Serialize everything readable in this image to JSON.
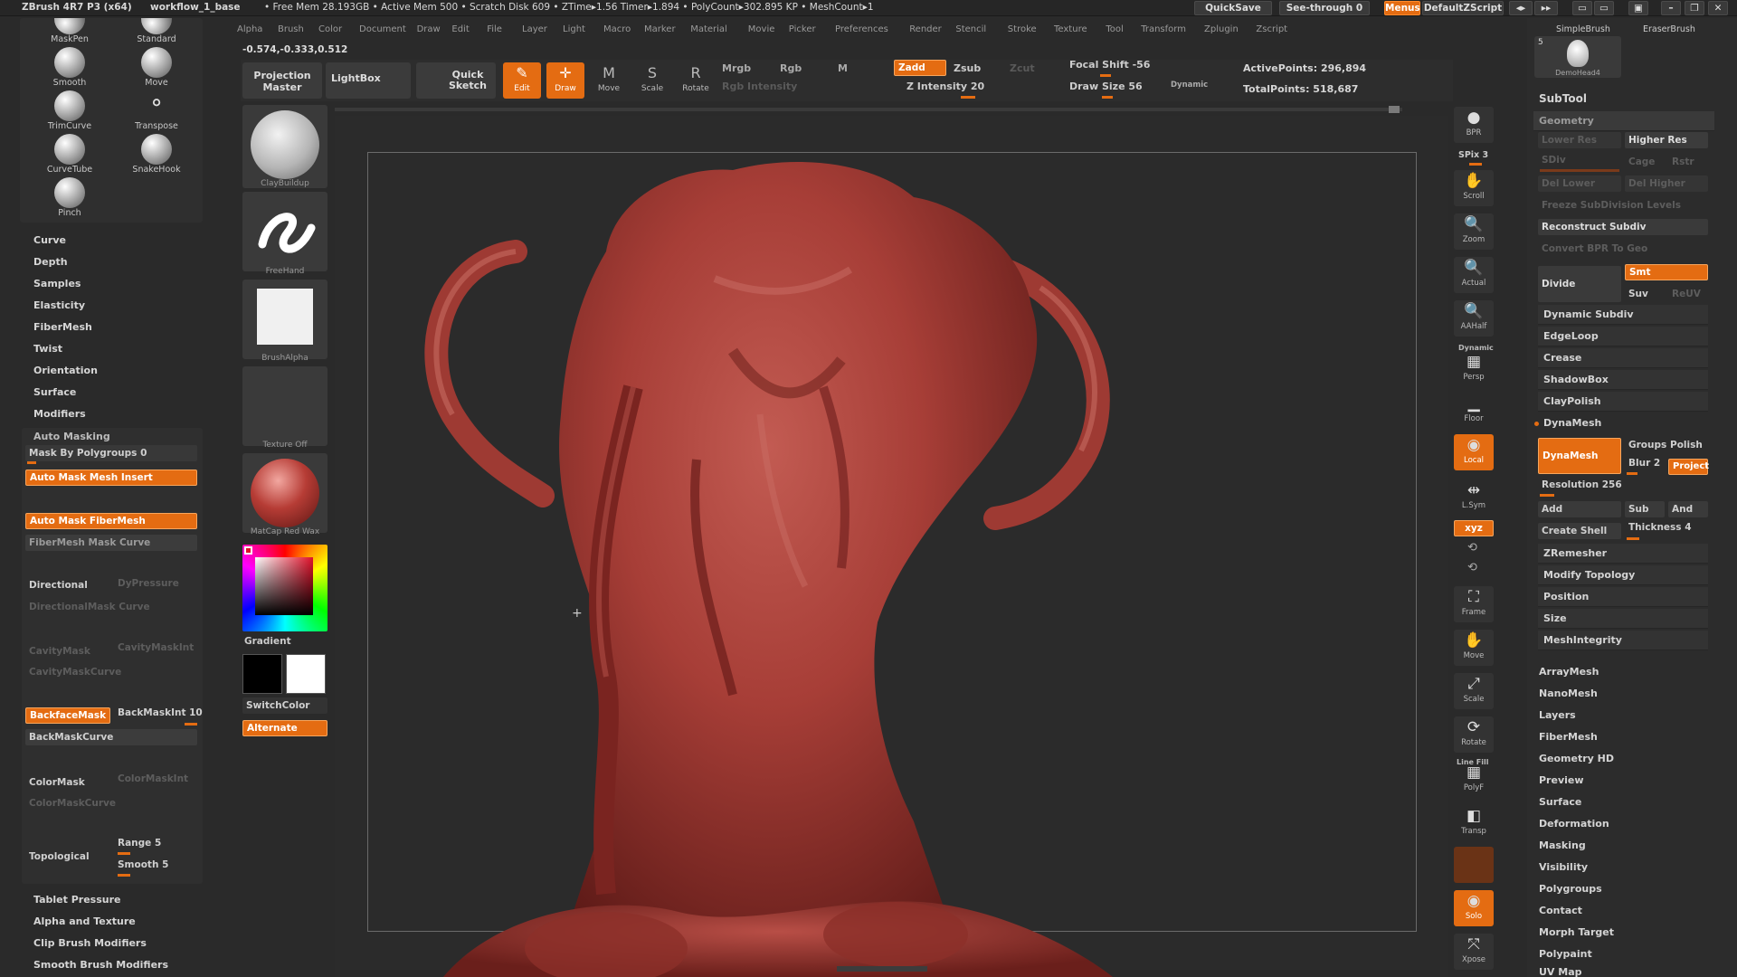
{
  "titlebar": {
    "app": "ZBrush 4R7 P3 (x64)",
    "doc": "workflow_1_base",
    "stats": "• Free Mem 28.193GB • Active Mem 500 • Scratch Disk 609 • ZTime▸1.56 Timer▸1.894 • PolyCount▸302.895 KP • MeshCount▸1",
    "quicksave": "QuickSave",
    "seethrough": "See-through  0",
    "menus": "Menus",
    "script": "DefaultZScript"
  },
  "menubar": [
    "Alpha",
    "Brush",
    "Color",
    "Document",
    "Draw",
    "Edit",
    "File",
    "Layer",
    "Light",
    "Macro",
    "Marker",
    "Material",
    "Movie",
    "Picker",
    "Preferences",
    "Render",
    "Stencil",
    "Stroke",
    "Texture",
    "Tool",
    "Transform",
    "Zplugin",
    "Zscript"
  ],
  "coords": "-0.574,-0.333,0.512",
  "brushes": [
    {
      "name": "MaskPen"
    },
    {
      "name": "Standard"
    },
    {
      "name": "Smooth"
    },
    {
      "name": "Move"
    },
    {
      "name": "TrimCurve"
    },
    {
      "name": "Transpose"
    },
    {
      "name": "CurveTube"
    },
    {
      "name": "SnakeHook"
    },
    {
      "name": "Pinch"
    }
  ],
  "left_menu": [
    "Curve",
    "Depth",
    "Samples",
    "Elasticity",
    "FiberMesh",
    "Twist",
    "Orientation",
    "Surface",
    "Modifiers"
  ],
  "automask": {
    "header": "Auto Masking",
    "mask_polygroups": "Mask By Polygroups 0",
    "mesh_insert": "Auto Mask Mesh Insert",
    "fibermesh": "Auto Mask FiberMesh",
    "fibermesh_curve": "FiberMesh Mask Curve",
    "directional": "Directional",
    "dypressure": "DyPressure",
    "directional_curve": "DirectionalMask Curve",
    "cavity": "CavityMask",
    "cavity_int": "CavityMaskInt",
    "cavity_curve": "CavityMaskCurve",
    "backface": "BackfaceMask",
    "backmask_int": "BackMaskInt 10",
    "backmask_curve": "BackMaskCurve",
    "colormask": "ColorMask",
    "colormask_int": "ColorMaskInt",
    "colormask_curve": "ColorMaskCurve",
    "topological": "Topological",
    "range": "Range 5",
    "smooth": "Smooth 5"
  },
  "left_bottom": [
    "Tablet Pressure",
    "Alpha and Texture",
    "Clip Brush Modifiers",
    "Smooth Brush Modifiers"
  ],
  "shelf": {
    "brush": "ClayBuildup",
    "stroke": "FreeHand",
    "alpha": "BrushAlpha",
    "texture": "Texture Off",
    "material": "MatCap Red Wax",
    "gradient": "Gradient",
    "switchcolor": "SwitchColor",
    "alternate": "Alternate"
  },
  "topbar": {
    "projection": "Projection Master",
    "lightbox": "LightBox",
    "quicksketch": "Quick Sketch",
    "edit": "Edit",
    "draw": "Draw",
    "move": "Move",
    "scale": "Scale",
    "rotate": "Rotate",
    "mrgb": "Mrgb",
    "rgb": "Rgb",
    "m": "M",
    "rgb_intensity": "Rgb Intensity",
    "zadd": "Zadd",
    "zsub": "Zsub",
    "zcut": "Zcut",
    "z_intensity": "Z Intensity 20",
    "focal_shift": "Focal Shift -56",
    "draw_size": "Draw Size 56",
    "dynamic": "Dynamic",
    "active_points": "ActivePoints: 296,894",
    "total_points": "TotalPoints: 518,687"
  },
  "right_tools": [
    {
      "label": "BPR",
      "icon": "●"
    },
    {
      "label": "Scroll",
      "icon": "✋"
    },
    {
      "label": "Zoom",
      "icon": "🔍"
    },
    {
      "label": "Actual",
      "icon": "🔍"
    },
    {
      "label": "AAHalf",
      "icon": "🔍"
    },
    {
      "label": "Persp",
      "icon": "▦"
    },
    {
      "label": "Floor",
      "icon": "▁"
    },
    {
      "label": "Local",
      "icon": "◉"
    },
    {
      "label": "L.Sym",
      "icon": "⇹"
    },
    {
      "label": "Frame",
      "icon": "⛶"
    },
    {
      "label": "Move",
      "icon": "✋"
    },
    {
      "label": "Scale",
      "icon": "⤢"
    },
    {
      "label": "Rotate",
      "icon": "⟳"
    },
    {
      "label": "PolyF",
      "icon": "▦"
    },
    {
      "label": "Transp",
      "icon": "◧"
    },
    {
      "label": "Solo",
      "icon": "◉"
    },
    {
      "label": "Xpose",
      "icon": "⤧"
    }
  ],
  "spix": "SPix 3",
  "dynamic_label": "Dynamic",
  "xyz": "xyz",
  "linefill": "Line Fill",
  "right_panel": {
    "simplebrush": "SimpleBrush",
    "eraserbrush": "EraserBrush",
    "demohead": "DemoHead4",
    "count": "5",
    "subtool": "SubTool",
    "geometry": "Geometry",
    "lower_res": "Lower Res",
    "higher_res": "Higher Res",
    "sdiv": "SDiv",
    "cage": "Cage",
    "rstr": "Rstr",
    "del_lower": "Del Lower",
    "del_higher": "Del Higher",
    "freeze": "Freeze SubDivision Levels",
    "reconstruct": "Reconstruct Subdiv",
    "convert_bpr": "Convert BPR To Geo",
    "divide": "Divide",
    "smt": "Smt",
    "suv": "Suv",
    "reuv": "ReUV",
    "dynamic_subdiv": "Dynamic Subdiv",
    "edgeloop": "EdgeLoop",
    "crease": "Crease",
    "shadowbox": "ShadowBox",
    "claypolish": "ClayPolish",
    "dynamesh_header": "DynaMesh",
    "dynamesh_btn": "DynaMesh",
    "groups": "Groups",
    "polish": "Polish",
    "blur": "Blur 2",
    "project": "Project",
    "resolution": "Resolution 256",
    "add": "Add",
    "sub": "Sub",
    "and": "And",
    "create_shell": "Create Shell",
    "thickness": "Thickness 4",
    "zremesher": "ZRemesher",
    "modify_topology": "Modify Topology",
    "position": "Position",
    "size": "Size",
    "meshintegrity": "MeshIntegrity",
    "sections": [
      "ArrayMesh",
      "NanoMesh",
      "Layers",
      "FiberMesh",
      "Geometry HD",
      "Preview",
      "Surface",
      "Deformation",
      "Masking",
      "Visibility",
      "Polygroups",
      "Contact",
      "Morph Target",
      "Polypaint",
      "UV Map"
    ]
  }
}
